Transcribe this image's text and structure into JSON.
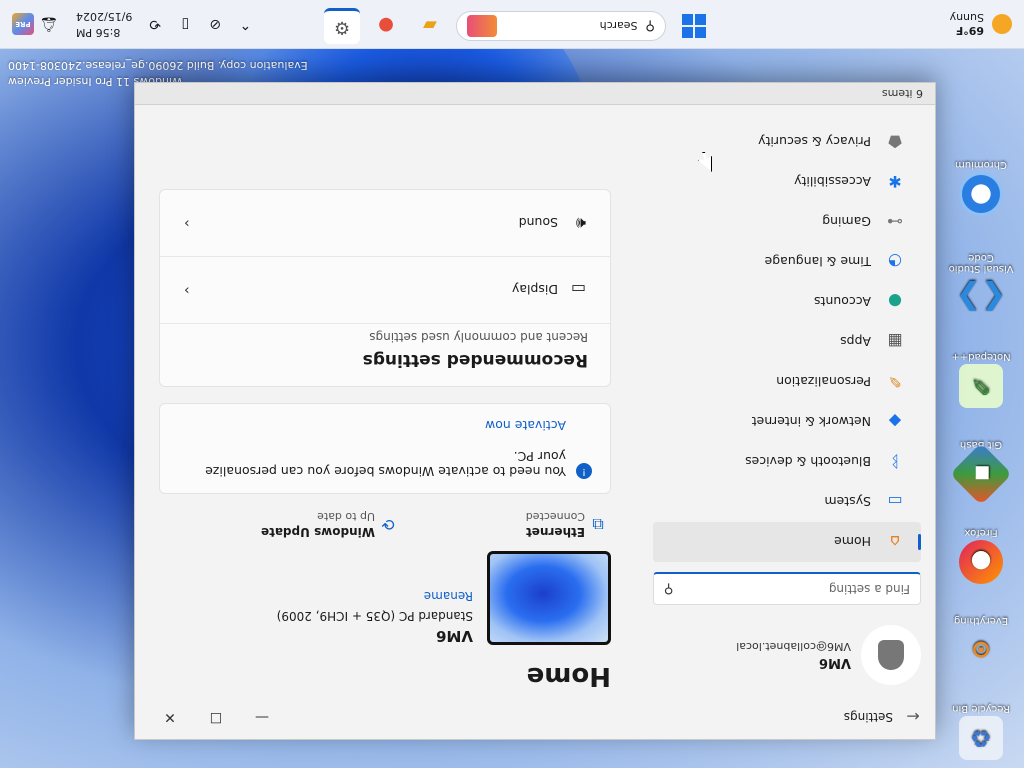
{
  "desktop": {
    "icons": [
      {
        "label": "Recycle Bin",
        "icon": "recycle-bin-icon"
      },
      {
        "label": "Everything",
        "icon": "search-icon"
      },
      {
        "label": "Firefox",
        "icon": "firefox-icon"
      },
      {
        "label": "Git Bash",
        "icon": "git-icon"
      },
      {
        "label": "Notepad++",
        "icon": "notepad-icon"
      },
      {
        "label": "Visual Studio Code",
        "icon": "vscode-icon"
      },
      {
        "label": "Chromium",
        "icon": "chromium-icon"
      }
    ],
    "watermark_line1": "Windows 11 Pro Insider Preview",
    "watermark_line2": "Evaluation copy. Build 26090.ge_release.240308-1400"
  },
  "window": {
    "title": "Settings",
    "controls": {
      "minimize": "—",
      "maximize": "☐",
      "close": "✕"
    },
    "status_bar": "6 items"
  },
  "nav": {
    "user_name": "VM6",
    "user_email": "VM6@collabnet.local",
    "search_placeholder": "Find a setting",
    "items": [
      {
        "label": "Home",
        "icon": "home-icon",
        "active": true
      },
      {
        "label": "System",
        "icon": "monitor-icon"
      },
      {
        "label": "Bluetooth & devices",
        "icon": "bluetooth-icon"
      },
      {
        "label": "Network & internet",
        "icon": "wifi-icon"
      },
      {
        "label": "Personalization",
        "icon": "brush-icon"
      },
      {
        "label": "Apps",
        "icon": "apps-icon"
      },
      {
        "label": "Accounts",
        "icon": "person-icon"
      },
      {
        "label": "Time & language",
        "icon": "globe-icon"
      },
      {
        "label": "Gaming",
        "icon": "gamepad-icon"
      },
      {
        "label": "Accessibility",
        "icon": "accessibility-icon"
      },
      {
        "label": "Privacy & security",
        "icon": "shield-icon"
      }
    ]
  },
  "main": {
    "title": "Home",
    "pc_name": "VM6",
    "pc_model": "Standard PC (Q35 + ICH9, 2009)",
    "rename": "Rename",
    "network": {
      "title": "Ethernet",
      "subtitle": "Connected"
    },
    "update": {
      "title": "Windows Update",
      "subtitle": "Up to date"
    },
    "activation": {
      "message": "You need to activate Windows before you can personalize your PC.",
      "link": "Activate now"
    },
    "recommended": {
      "title": "Recommended settings",
      "subtitle": "Recent and commonly used settings",
      "items": [
        {
          "label": "Display",
          "icon": "display-icon"
        },
        {
          "label": "Sound",
          "icon": "speaker-icon"
        }
      ]
    }
  },
  "taskbar": {
    "weather": {
      "temp": "69°F",
      "condition": "Sunny"
    },
    "search_placeholder": "Search",
    "apps": [
      "file-explorer-icon",
      "firefox-icon",
      "settings-icon"
    ],
    "clock_time": "8:56 PM",
    "clock_date": "9/15/2024",
    "pre_badge": "PRE"
  }
}
